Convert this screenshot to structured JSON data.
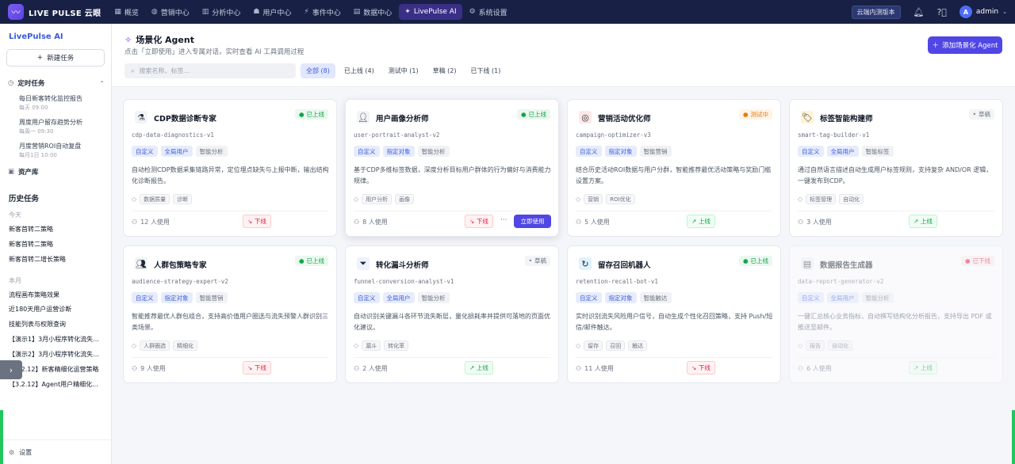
{
  "app": {
    "logo_text": "LIVE PULSE 云眼",
    "logo_icon": "pulse-icon"
  },
  "nav": [
    {
      "label": "概览",
      "icon": "grid-icon"
    },
    {
      "label": "营销中心",
      "icon": "globe-icon"
    },
    {
      "label": "分析中心",
      "icon": "bar-chart-icon"
    },
    {
      "label": "用户中心",
      "icon": "users-icon"
    },
    {
      "label": "事件中心",
      "icon": "events-icon"
    },
    {
      "label": "数据中心",
      "icon": "database-icon"
    },
    {
      "label": "LivePulse AI",
      "icon": "sparkle-icon",
      "active": true
    },
    {
      "label": "系统设置",
      "icon": "gear-icon"
    }
  ],
  "topbar": {
    "env_badge": "云端内测版本",
    "user_initial": "A",
    "user_name": "admin"
  },
  "sidebar": {
    "title": "LivePulse AI",
    "new_task": "新建任务",
    "scheduled_label": "定时任务",
    "scheduled": [
      {
        "name": "每日新客转化监控报告",
        "time": "每天 09:00"
      },
      {
        "name": "周度用户留存趋势分析",
        "time": "每周一 09:30"
      },
      {
        "name": "月度营销ROI自动复盘",
        "time": "每月1日 10:00"
      }
    ],
    "assets_label": "资产库",
    "history_title": "历史任务",
    "today_label": "今天",
    "today": [
      "新客首转二策略",
      "新客首转二策略",
      "新客首转二增长策略"
    ],
    "month_label": "本月",
    "month": [
      "流程画布策略效果",
      "近180天用户运营诊断",
      "技能列表与权限查询",
      "【演示1】3月小程序转化流失...",
      "【演示2】3月小程序转化流失...",
      "【3.2.12】新客精细化运营策略",
      "【3.2.12】Agent用户精细化..."
    ],
    "settings": "设置"
  },
  "header": {
    "title": "场景化 Agent",
    "subtitle": "点击「立即使用」进入专属对话，实时查看 AI 工具调用过程",
    "add_button": "添加场景化 Agent",
    "search_placeholder": "搜索名称、标签..."
  },
  "filters": [
    "全部 (8)",
    "已上线 (4)",
    "测试中 (1)",
    "草稿 (2)",
    "已下线 (1)"
  ],
  "cards": [
    {
      "name": "CDP数据诊断专家",
      "icon": "flask-icon",
      "status": "已上线",
      "status_type": "on",
      "slug": "cdp-data-diagnostics-v1",
      "tags": [
        "自定义",
        "全局用户"
      ],
      "category": "智能分析",
      "desc": "自动检测CDP数据采集链路异常，定位埋点缺失与上报中断，输出结构化诊断报告。",
      "keywords": [
        "数据质量",
        "诊断"
      ],
      "users": "12 人使用",
      "action": "下线",
      "action_type": "off"
    },
    {
      "name": "用户画像分析师",
      "icon": "user-icon",
      "status": "已上线",
      "status_type": "on",
      "slug": "user-portrait-analyst-v2",
      "tags": [
        "自定义",
        "指定对象"
      ],
      "category": "智能分析",
      "desc": "基于CDP多维标签数据，深度分析目标用户群体的行为偏好与消费能力规律。",
      "keywords": [
        "用户分析",
        "画像"
      ],
      "users": "8 人使用",
      "action": "下线",
      "action_type": "off",
      "more": "···",
      "use": "立即使用"
    },
    {
      "name": "营销活动优化师",
      "icon": "target-icon",
      "status": "测试中",
      "status_type": "test",
      "slug": "campaign-optimizer-v3",
      "tags": [
        "自定义",
        "指定对象"
      ],
      "category": "智能营销",
      "desc": "结合历史活动ROI数据与用户分群，智能推荐最优活动策略与奖励门槛设置方案。",
      "keywords": [
        "营销",
        "ROI优化"
      ],
      "users": "5 人使用",
      "action": "上线",
      "action_type": "on"
    },
    {
      "name": "标签智能构建师",
      "icon": "tag-icon",
      "status": "草稿",
      "status_type": "draft",
      "slug": "smart-tag-builder-v1",
      "tags": [
        "自定义",
        "全局用户"
      ],
      "category": "智能标签",
      "desc": "通过自然语言描述自动生成用户标签规则，支持复杂 AND/OR 逻辑，一键发布到CDP。",
      "keywords": [
        "标签管理",
        "自动化"
      ],
      "users": "3 人使用",
      "action": "上线",
      "action_type": "on"
    },
    {
      "name": "人群包策略专家",
      "icon": "audience-icon",
      "status": "已上线",
      "status_type": "on",
      "slug": "audience-strategy-expert-v2",
      "tags": [
        "自定义",
        "指定对象"
      ],
      "category": "智能营销",
      "desc": "智能推荐最优人群包组合，支持高价值用户圈选与流失预警人群识别三类场景。",
      "keywords": [
        "人群圈选",
        "精细化"
      ],
      "users": "9 人使用",
      "action": "下线",
      "action_type": "off"
    },
    {
      "name": "转化漏斗分析师",
      "icon": "funnel-icon",
      "status": "草稿",
      "status_type": "draft",
      "slug": "funnel-conversion-analyst-v1",
      "tags": [
        "自定义",
        "全局用户"
      ],
      "category": "智能分析",
      "desc": "自动识别关键漏斗各环节流失断层，量化损耗率并提供可落地的页面优化建议。",
      "keywords": [
        "漏斗",
        "转化率"
      ],
      "users": "2 人使用",
      "action": "上线",
      "action_type": "on"
    },
    {
      "name": "留存召回机器人",
      "icon": "recycle-icon",
      "status": "已上线",
      "status_type": "on",
      "slug": "retention-recall-bot-v1",
      "tags": [
        "自定义",
        "指定对象"
      ],
      "category": "智能触达",
      "desc": "实时识别流失风险用户信号，自动生成个性化召回策略，支持 Push/短信/邮件触达。",
      "keywords": [
        "留存",
        "召回",
        "触达"
      ],
      "users": "11 人使用",
      "action": "下线",
      "action_type": "off"
    },
    {
      "name": "数据报告生成器",
      "icon": "report-icon",
      "status": "已下线",
      "status_type": "off",
      "slug": "data-report-generator-v2",
      "tags": [
        "自定义",
        "全局用户"
      ],
      "category": "智能分析",
      "desc": "一键汇总核心业务指标，自动撰写结构化分析报告，支持导出 PDF 或推送至邮件。",
      "keywords": [
        "报告",
        "自动化"
      ],
      "users": "6 人使用",
      "action": "上线",
      "action_type": "on",
      "faded": true
    }
  ]
}
